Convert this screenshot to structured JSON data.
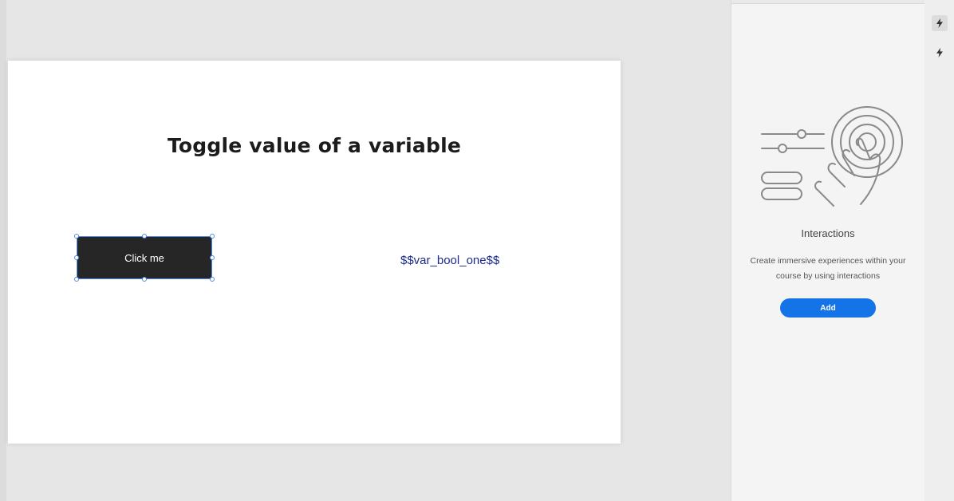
{
  "slide": {
    "title": "Toggle value of a variable",
    "button_label": "Click me",
    "variable_text": "$$var_bool_one$$"
  },
  "panel": {
    "heading": "Interactions",
    "description": "Create immersive experiences within your course by using interactions",
    "add_label": "Add",
    "illustration_icon": "hand-tap-illustration"
  },
  "rail": {
    "icons": [
      "interactions-icon",
      "interactions-icon"
    ]
  },
  "colors": {
    "accent": "#1473e6",
    "button_bg": "#262626",
    "variable_text": "#1c2a8c"
  }
}
